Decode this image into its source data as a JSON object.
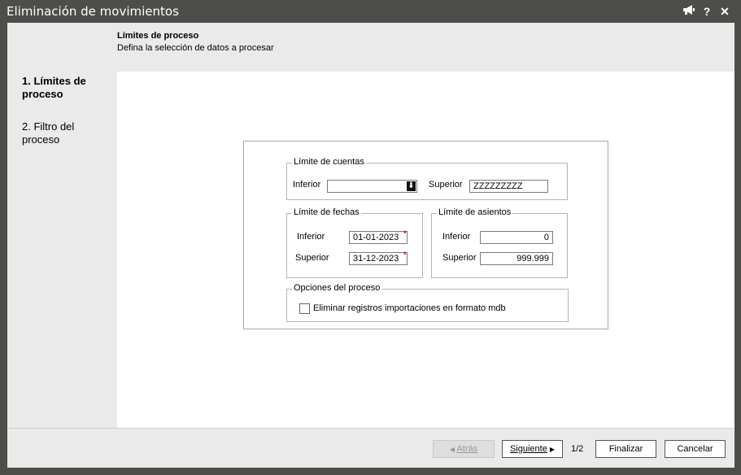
{
  "window": {
    "title": "Eliminación de movimientos"
  },
  "header": {
    "title": "Límites de proceso",
    "subtitle": "Defina la selección de datos a procesar"
  },
  "steps": [
    {
      "label": "1. Límites de proceso",
      "active": true
    },
    {
      "label": "2. Filtro del proceso",
      "active": false
    }
  ],
  "cuentas": {
    "legend": "Límite de cuentas",
    "inferior_label": "Inferior",
    "inferior_value": "",
    "superior_label": "Superior",
    "superior_value": "ZZZZZZZZZ"
  },
  "fechas": {
    "legend": "Límite de fechas",
    "inferior_label": "Inferior",
    "inferior_value": "01-01-2023",
    "superior_label": "Superior",
    "superior_value": "31-12-2023",
    "required_mark": "*"
  },
  "asientos": {
    "legend": "Límite de asientos",
    "inferior_label": "Inferior",
    "inferior_value": "0",
    "superior_label": "Superior",
    "superior_value": "999.999"
  },
  "opciones": {
    "legend": "Opciones del proceso",
    "checkbox_label": "Eliminar registros importaciones en formato mdb",
    "checked": false
  },
  "footer": {
    "back_label": "Atrás",
    "next_label": "Siguiente",
    "page": "1/2",
    "finish_label": "Finalizar",
    "cancel_label": "Cancelar"
  },
  "icons": [
    "megaphone-icon",
    "help-icon",
    "close-icon",
    "dropdown-arrow-icon",
    "arrow-left-icon",
    "arrow-right-icon"
  ],
  "colors": {
    "titlebar": "#4d4d4a",
    "panel": "#eaeaea",
    "required": "#dd0000"
  }
}
